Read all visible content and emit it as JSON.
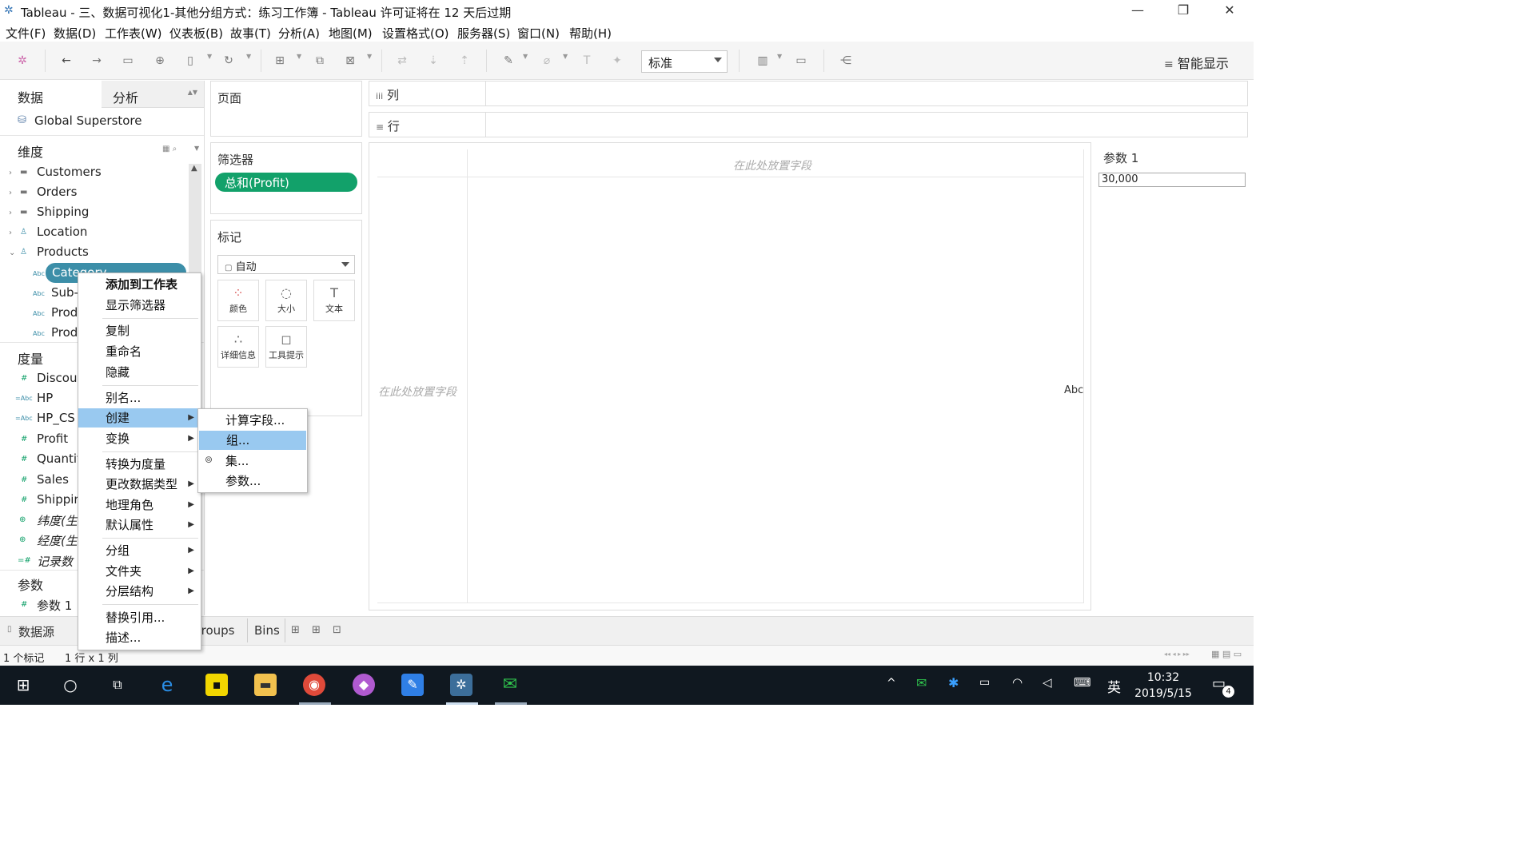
{
  "window": {
    "title": "Tableau - 三、数据可视化1-其他分组方式：练习工作簿 - Tableau 许可证将在 12 天后过期",
    "minimize": "—",
    "maximize": "❐",
    "close": "✕"
  },
  "menubar": [
    "文件(F)",
    "数据(D)",
    "工作表(W)",
    "仪表板(B)",
    "故事(T)",
    "分析(A)",
    "地图(M)",
    "设置格式(O)",
    "服务器(S)",
    "窗口(N)",
    "帮助(H)"
  ],
  "toolbar": {
    "fit_select": "标准",
    "show_me": "智能显示"
  },
  "data_pane": {
    "tab_data": "数据",
    "tab_analysis": "分析",
    "datasource": "Global Superstore",
    "dimensions_title": "维度",
    "dimensions": [
      {
        "label": "Customers",
        "icon": "folder-icon"
      },
      {
        "label": "Orders",
        "icon": "folder-icon"
      },
      {
        "label": "Shipping",
        "icon": "folder-icon"
      },
      {
        "label": "Location",
        "icon": "hierarchy-icon"
      },
      {
        "label": "Products",
        "icon": "hierarchy-icon"
      }
    ],
    "product_fields": [
      "Category",
      "Sub-",
      "Prod",
      "Prod"
    ],
    "measures_title": "度量",
    "measures": [
      {
        "label": "Discou",
        "type": "#"
      },
      {
        "label": "HP",
        "type": "=Abc"
      },
      {
        "label": "HP_CS",
        "type": "=Abc"
      },
      {
        "label": "Profit",
        "type": "#"
      },
      {
        "label": "Quantit",
        "type": "#"
      },
      {
        "label": "Sales",
        "type": "#"
      },
      {
        "label": "Shippir",
        "type": "#"
      },
      {
        "label": "纬度(生",
        "type": "⊕"
      },
      {
        "label": "经度(生",
        "type": "⊕"
      },
      {
        "label": "记录数",
        "type": "=#"
      }
    ],
    "parameters_title": "参数",
    "parameters": [
      "参数 1"
    ]
  },
  "cards": {
    "pages": "页面",
    "filters": "筛选器",
    "filter_pill": "总和(Profit)",
    "marks": "标记",
    "mark_type": "自动",
    "mark_buttons": [
      "颜色",
      "大小",
      "文本",
      "详细信息",
      "工具提示"
    ]
  },
  "shelves": {
    "columns": "列",
    "rows": "行"
  },
  "canvas": {
    "drop_hint_top": "在此处放置字段",
    "drop_hint_left": "在此处放置字段",
    "abc": "Abc"
  },
  "parameter_card": {
    "title": "参数 1",
    "value": "30,000"
  },
  "context_menu": {
    "items": [
      {
        "label": "添加到工作表",
        "bold": true
      },
      {
        "label": "显示筛选器"
      },
      {
        "label": "复制"
      },
      {
        "label": "重命名"
      },
      {
        "label": "隐藏"
      },
      {
        "label": "别名..."
      },
      {
        "label": "创建",
        "sub": true,
        "highlight": true
      },
      {
        "label": "变换",
        "sub": true
      },
      {
        "label": "转换为度量"
      },
      {
        "label": "更改数据类型",
        "sub": true
      },
      {
        "label": "地理角色",
        "sub": true
      },
      {
        "label": "默认属性",
        "sub": true
      },
      {
        "label": "分组",
        "sub": true
      },
      {
        "label": "文件夹",
        "sub": true
      },
      {
        "label": "分层结构",
        "sub": true
      },
      {
        "label": "替换引用..."
      },
      {
        "label": "描述..."
      }
    ],
    "submenu": [
      "计算字段...",
      "组...",
      "集...",
      "参数..."
    ]
  },
  "bottom_tabs": {
    "datasource": "数据源",
    "tabs": [
      "Groups",
      "Bins"
    ]
  },
  "status": {
    "marks": "1 个标记",
    "grid": "1 行 x 1 列"
  },
  "taskbar": {
    "ime": "英",
    "time": "10:32",
    "date": "2019/5/15",
    "notif_count": "4"
  }
}
